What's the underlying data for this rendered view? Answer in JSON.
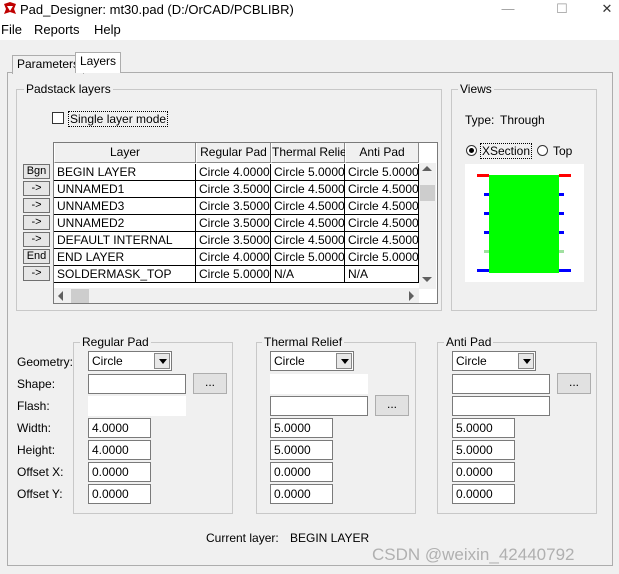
{
  "window": {
    "title": "Pad_Designer: mt30.pad (D:/OrCAD/PCBLIBR)",
    "minimize": "—",
    "maximize": "☐",
    "close": "✕"
  },
  "menu": [
    "File",
    "Reports",
    "Help"
  ],
  "tabs": [
    {
      "label": "Parameters",
      "active": false
    },
    {
      "label": "Layers",
      "active": true
    }
  ],
  "padstack": {
    "legend": "Padstack layers",
    "single_layer_mode": {
      "label": "Single layer mode",
      "checked": false
    },
    "columns": [
      "Layer",
      "Regular Pad",
      "Thermal Relief",
      "Anti Pad"
    ],
    "rows": [
      {
        "btn": "Bgn",
        "cells": [
          "BEGIN LAYER",
          "Circle 4.0000",
          "Circle 5.0000",
          "Circle 5.0000"
        ],
        "selected": true
      },
      {
        "btn": "->",
        "cells": [
          "UNNAMED1",
          "Circle 3.5000",
          "Circle 4.5000",
          "Circle 4.5000"
        ]
      },
      {
        "btn": "->",
        "cells": [
          "UNNAMED3",
          "Circle 3.5000",
          "Circle 4.5000",
          "Circle 4.5000"
        ]
      },
      {
        "btn": "->",
        "cells": [
          "UNNAMED2",
          "Circle 3.5000",
          "Circle 4.5000",
          "Circle 4.5000"
        ]
      },
      {
        "btn": "->",
        "cells": [
          "DEFAULT INTERNAL",
          "Circle 3.5000",
          "Circle 4.5000",
          "Circle 4.5000"
        ]
      },
      {
        "btn": "End",
        "cells": [
          "END LAYER",
          "Circle 4.0000",
          "Circle 5.0000",
          "Circle 5.0000"
        ]
      },
      {
        "btn": "->",
        "cells": [
          "SOLDERMASK_TOP",
          "Circle 5.0000",
          "N/A",
          "N/A"
        ]
      }
    ]
  },
  "views": {
    "legend": "Views",
    "type_label": "Type:",
    "type_value": "Through",
    "radio_xsection": {
      "label": "XSection",
      "selected": true
    },
    "radio_top": {
      "label": "Top",
      "selected": false
    },
    "colors": {
      "body": "#00ff00",
      "outer_pad": "#ff0000",
      "inner_pad": "#0000ff",
      "plane": "#a0e0a0"
    }
  },
  "row_labels": [
    "Geometry:",
    "Shape:",
    "Flash:",
    "Width:",
    "Height:",
    "Offset X:",
    "Offset Y:"
  ],
  "regular_pad": {
    "legend": "Regular Pad",
    "geometry": "Circle",
    "shape": "",
    "shape_btn": "...",
    "flash": "",
    "width": "4.0000",
    "height": "4.0000",
    "offset_x": "0.0000",
    "offset_y": "0.0000"
  },
  "thermal_relief": {
    "legend": "Thermal Relief",
    "geometry": "Circle",
    "shape": "",
    "flash": "",
    "flash_btn": "...",
    "width": "5.0000",
    "height": "5.0000",
    "offset_x": "0.0000",
    "offset_y": "0.0000"
  },
  "anti_pad": {
    "legend": "Anti Pad",
    "geometry": "Circle",
    "shape": "",
    "shape_btn": "...",
    "flash": "",
    "width": "5.0000",
    "height": "5.0000",
    "offset_x": "0.0000",
    "offset_y": "0.0000"
  },
  "current_layer": {
    "label": "Current layer:",
    "value": "BEGIN LAYER"
  },
  "watermark": "CSDN @weixin_42440792"
}
